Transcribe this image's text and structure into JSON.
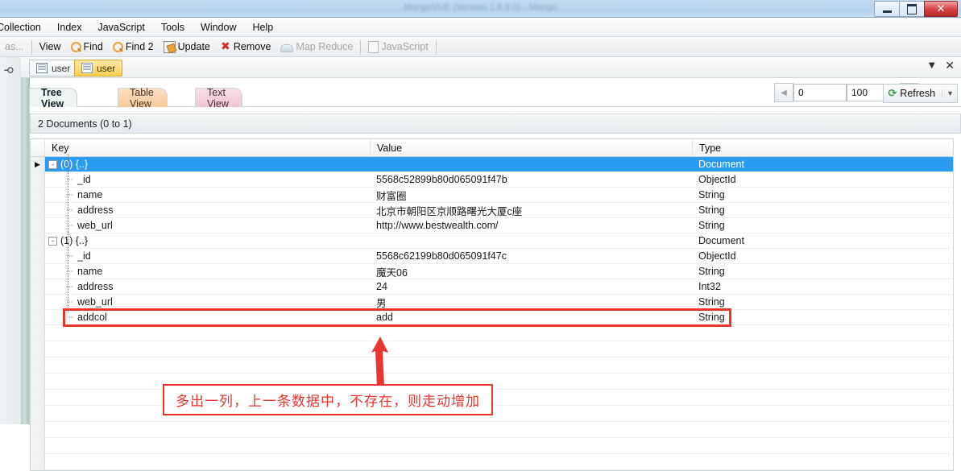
{
  "window": {
    "title": "MongoVUE (Version 1.6.9.0) - Mongo",
    "buttons": {
      "minimize": "minimize-button",
      "maximize": "maximize-button",
      "close": "close-button"
    }
  },
  "menubar": {
    "items": [
      {
        "label": "Collection"
      },
      {
        "label": "Index"
      },
      {
        "label": "JavaScript"
      },
      {
        "label": "Tools"
      },
      {
        "label": "Window"
      },
      {
        "label": "Help"
      }
    ]
  },
  "toolbar": {
    "overflow_label": "as...",
    "items": [
      {
        "label": "View",
        "icon": "",
        "disabled": false
      },
      {
        "label": "Find",
        "icon": "magnifier-icon",
        "disabled": false
      },
      {
        "label": "Find 2",
        "icon": "magnifier-icon",
        "disabled": false
      },
      {
        "label": "Update",
        "icon": "update-icon",
        "disabled": false
      },
      {
        "label": "Remove",
        "icon": "remove-icon",
        "disabled": false
      },
      {
        "label": "Map Reduce",
        "icon": "map-reduce-icon",
        "disabled": true
      },
      {
        "label": "JavaScript",
        "icon": "javascript-icon",
        "disabled": true
      }
    ]
  },
  "collection_tabs": {
    "pin_icon": "pin-icon",
    "tabs": [
      {
        "label": "user",
        "active": false
      },
      {
        "label": "user",
        "active": true
      }
    ],
    "dropdown_icon": "chevron-down-icon",
    "close_icon": "close-icon"
  },
  "view_tabs": [
    {
      "label": "Tree View",
      "active": true
    },
    {
      "label": "Table View",
      "active": false
    },
    {
      "label": "Text View",
      "active": false
    }
  ],
  "pager": {
    "prev_icon": "triangle-left-icon",
    "skip_value": "0",
    "limit_value": "100",
    "next_icon": "triangle-right-icon",
    "refresh_label": "Refresh",
    "refresh_icon": "refresh-icon",
    "refresh_caret": "▼"
  },
  "document_bar": {
    "text": "2 Documents (0 to 1)"
  },
  "grid": {
    "columns": [
      "Key",
      "Value",
      "Type"
    ],
    "rows": [
      {
        "indent": 0,
        "node": "root",
        "expander": "-",
        "key": "(0) {..}",
        "value": "",
        "type": "Document",
        "selected": true,
        "row_marker": "▶"
      },
      {
        "indent": 1,
        "node": "leaf",
        "key": "_id",
        "value": "5568c52899b80d065091f47b",
        "type": "ObjectId",
        "selected": false
      },
      {
        "indent": 1,
        "node": "leaf",
        "key": "name",
        "value": "财富圈",
        "type": "String",
        "selected": false
      },
      {
        "indent": 1,
        "node": "leaf",
        "key": "address",
        "value": "北京市朝阳区京顺路曙光大厦c座",
        "type": "String",
        "selected": false
      },
      {
        "indent": 1,
        "node": "leaf",
        "key": "web_url",
        "value": "http://www.bestwealth.com/",
        "type": "String",
        "selected": false
      },
      {
        "indent": 0,
        "node": "root",
        "expander": "-",
        "key": "(1) {..}",
        "value": "",
        "type": "Document",
        "selected": false
      },
      {
        "indent": 1,
        "node": "leaf",
        "key": "_id",
        "value": "5568c62199b80d065091f47c",
        "type": "ObjectId",
        "selected": false
      },
      {
        "indent": 1,
        "node": "leaf",
        "key": "name",
        "value": "魔天06",
        "type": "String",
        "selected": false
      },
      {
        "indent": 1,
        "node": "leaf",
        "key": "address",
        "value": "24",
        "type": "Int32",
        "selected": false
      },
      {
        "indent": 1,
        "node": "leaf",
        "key": "web_url",
        "value": "男",
        "type": "String",
        "selected": false
      },
      {
        "indent": 1,
        "node": "leaf",
        "key": "addcol",
        "value": "add",
        "type": "String",
        "selected": false,
        "highlighted": true
      }
    ],
    "empty_row_count": 9
  },
  "annotation": {
    "text": "多出一列，上一条数据中，不存在，则走动增加",
    "color": "#e8352e",
    "arrow_icon": "arrow-up-icon"
  },
  "colors": {
    "selection": "#2a9bf0",
    "annotation_red": "#e8352e",
    "active_tab": "#fccf54"
  }
}
